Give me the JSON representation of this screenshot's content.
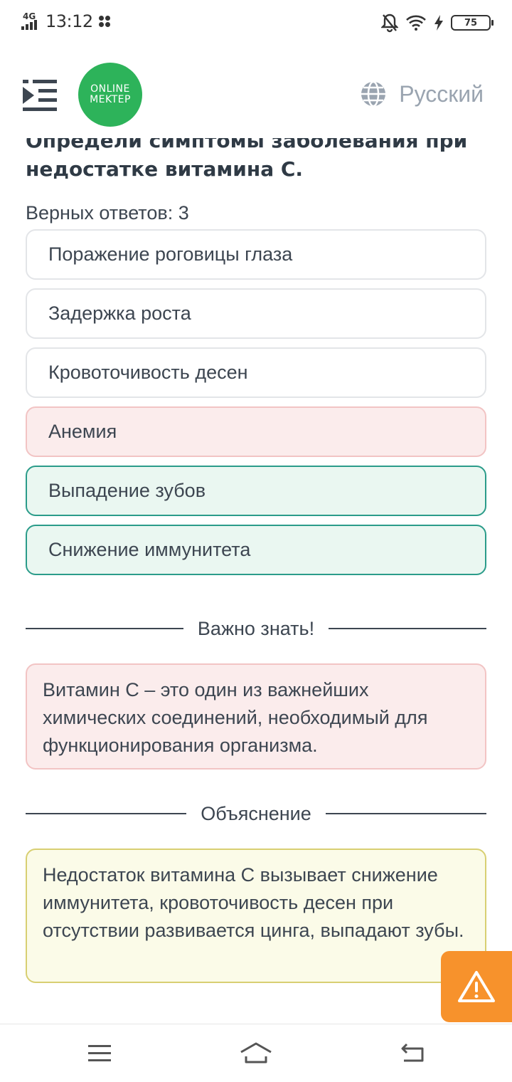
{
  "status_bar": {
    "network": "4G",
    "time": "13:12",
    "battery": "75"
  },
  "header": {
    "logo_line1": "ONLINE",
    "logo_line2": "MEKTEP",
    "language": "Русский"
  },
  "question": {
    "text_cut": "Определи симптомы заболевания при",
    "text": "недостатке витамина С."
  },
  "answers_count": "Верных ответов: 3",
  "options": [
    {
      "label": "Поражение роговицы глаза",
      "state": "neutral"
    },
    {
      "label": "Задержка роста",
      "state": "neutral"
    },
    {
      "label": "Кровоточивость десен",
      "state": "neutral"
    },
    {
      "label": "Анемия",
      "state": "wrong"
    },
    {
      "label": "Выпадение зубов",
      "state": "correct"
    },
    {
      "label": "Снижение иммунитета",
      "state": "correct"
    }
  ],
  "important": {
    "title": "Важно знать!",
    "text": "Витамин С – это один из важнейших химических соединений, необходимый для функционирования организма."
  },
  "explanation": {
    "title": "Объяснение",
    "text": "Недостаток витамина С вызывает снижение иммунитета, кровоточивость десен при отсутствии развивается цинга, выпадают зубы."
  },
  "colors": {
    "logo_green": "#2db35a",
    "warning_orange": "#f7922c",
    "correct_border": "#2b9c8a",
    "wrong_bg": "#fbecec"
  }
}
